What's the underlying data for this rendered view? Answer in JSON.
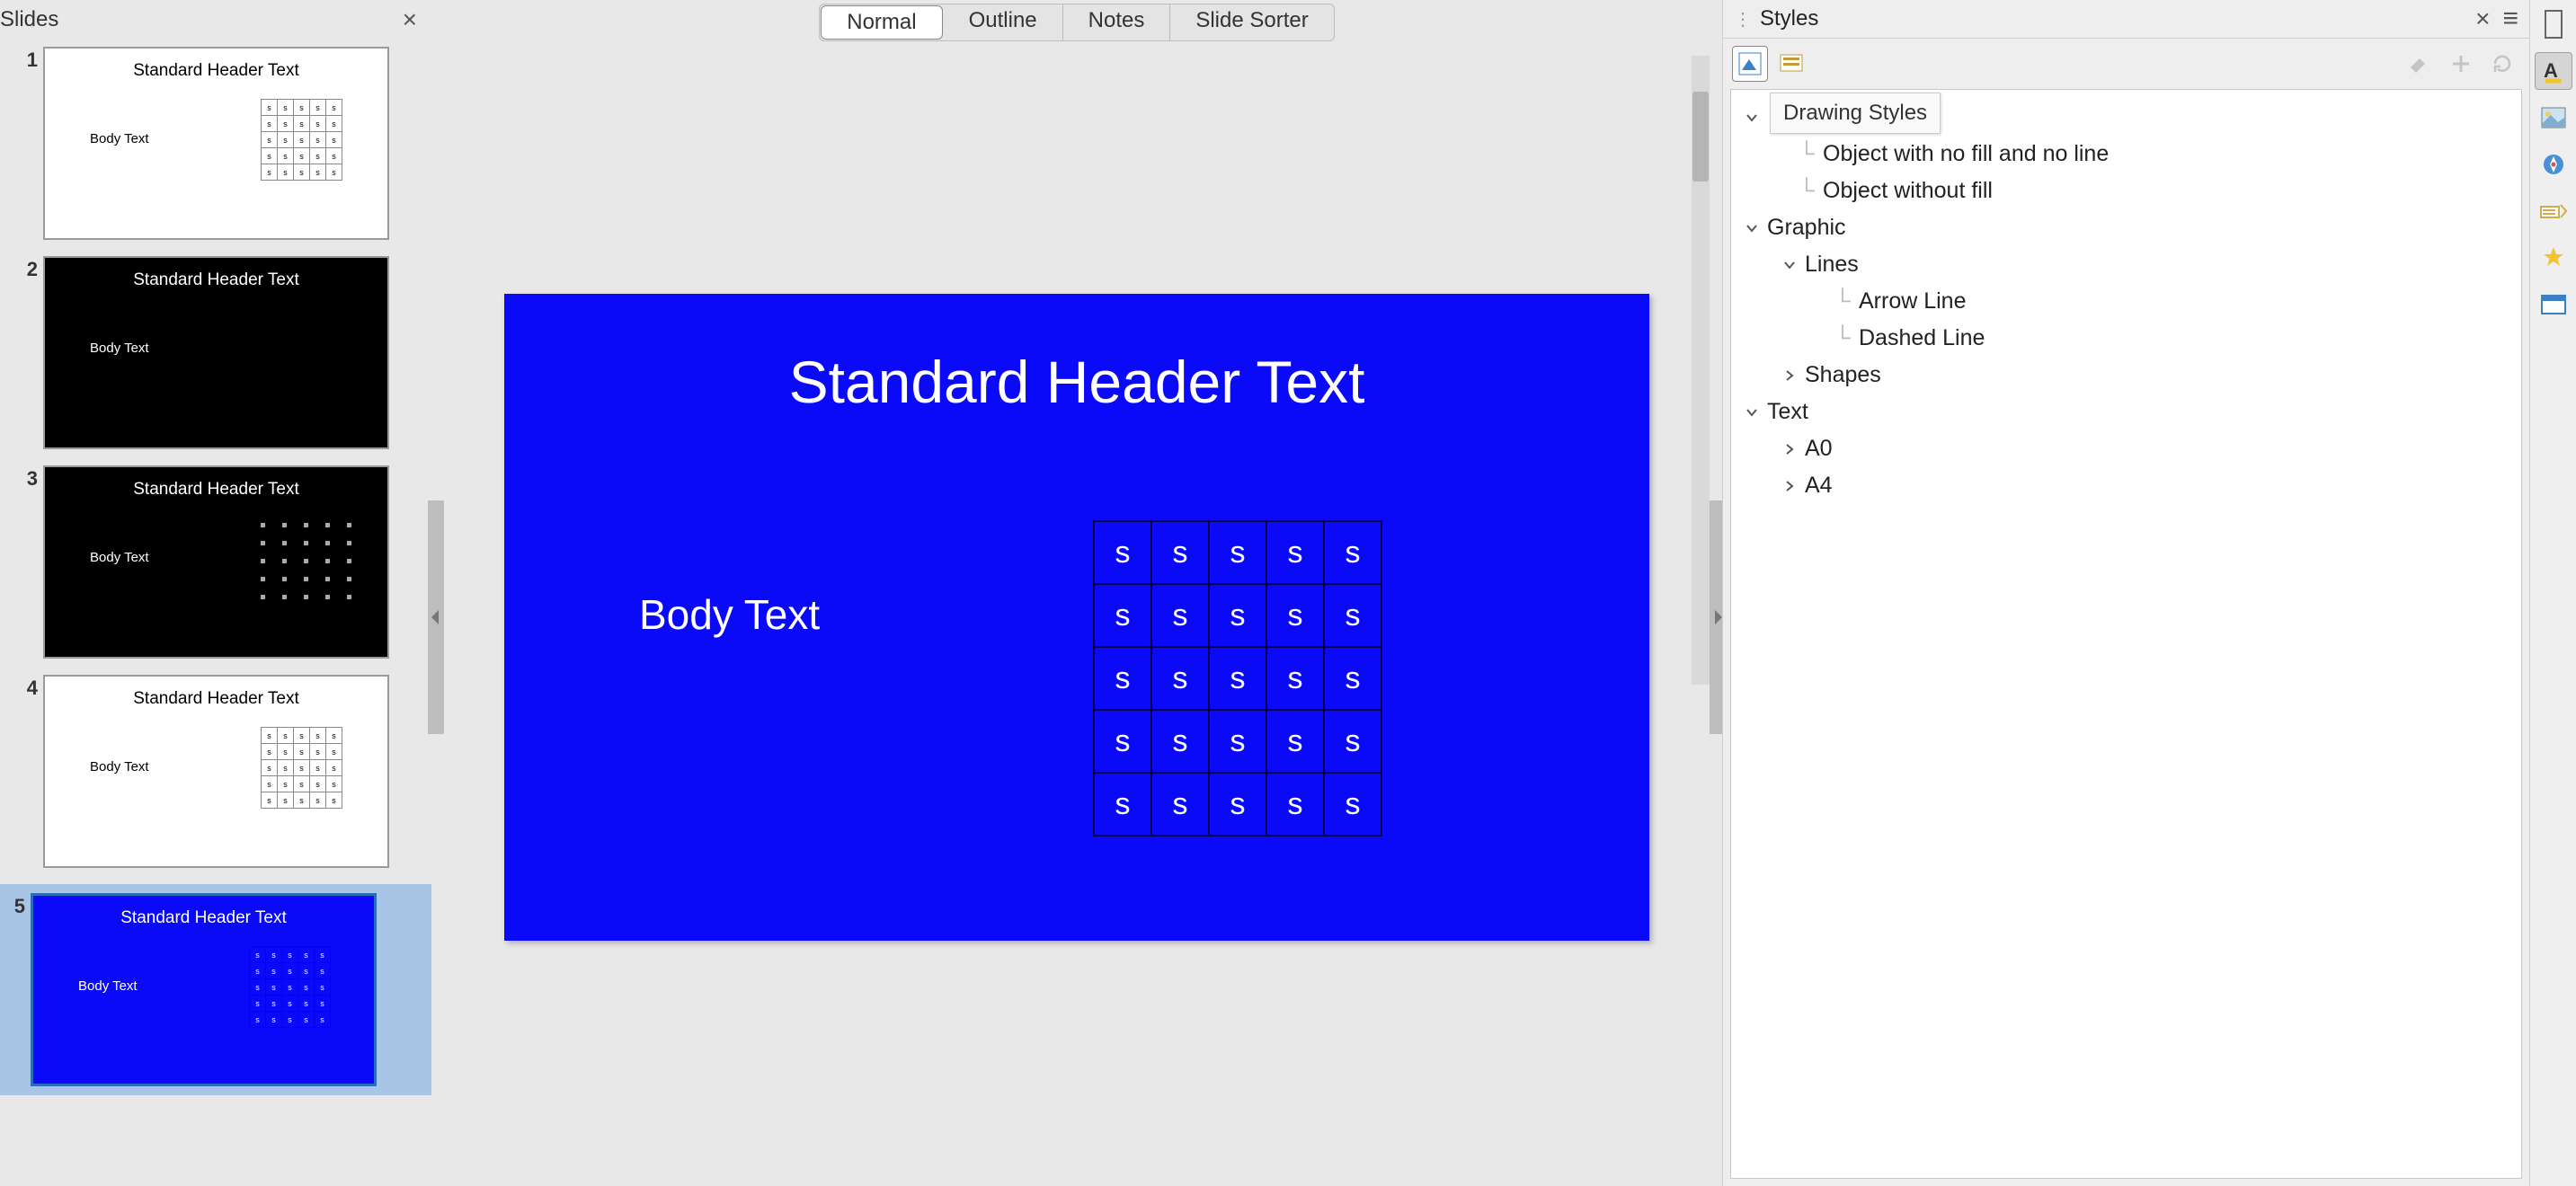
{
  "slidesPanel": {
    "title": "Slides",
    "slides": [
      {
        "num": "1",
        "theme": "light",
        "header": "Standard Header Text",
        "body": "Body Text"
      },
      {
        "num": "2",
        "theme": "dark",
        "header": "Standard Header Text",
        "body": "Body Text"
      },
      {
        "num": "3",
        "theme": "dark",
        "header": "Standard Header Text",
        "body": "Body Text"
      },
      {
        "num": "4",
        "theme": "light",
        "header": "Standard Header Text",
        "body": "Body Text"
      },
      {
        "num": "5",
        "theme": "blue",
        "header": "Standard Header Text",
        "body": "Body Text",
        "selected": true
      }
    ]
  },
  "viewTabs": {
    "normal": "Normal",
    "outline": "Outline",
    "notes": "Notes",
    "sorter": "Slide Sorter",
    "active": "normal"
  },
  "editorSlide": {
    "header": "Standard Header Text",
    "body": "Body Text",
    "tableCell": "s",
    "tableRows": 5,
    "tableCols": 5
  },
  "stylesPanel": {
    "title": "Styles",
    "tooltip": "Drawing Styles",
    "tree": {
      "defaultDrawingStyle": {
        "label": "Style",
        "fullVisible": "Style"
      },
      "objectNoFillNoLine": {
        "label": "Object with no fill and no line"
      },
      "objectWithoutFill": {
        "label": "Object without fill"
      },
      "graphic": {
        "label": "Graphic"
      },
      "lines": {
        "label": "Lines"
      },
      "arrowLine": {
        "label": "Arrow Line"
      },
      "dashedLine": {
        "label": "Dashed Line"
      },
      "shapes": {
        "label": "Shapes"
      },
      "text": {
        "label": "Text"
      },
      "a0": {
        "label": "A0"
      },
      "a4": {
        "label": "A4"
      }
    }
  },
  "colors": {
    "slideBlue": "#0a0af8"
  }
}
